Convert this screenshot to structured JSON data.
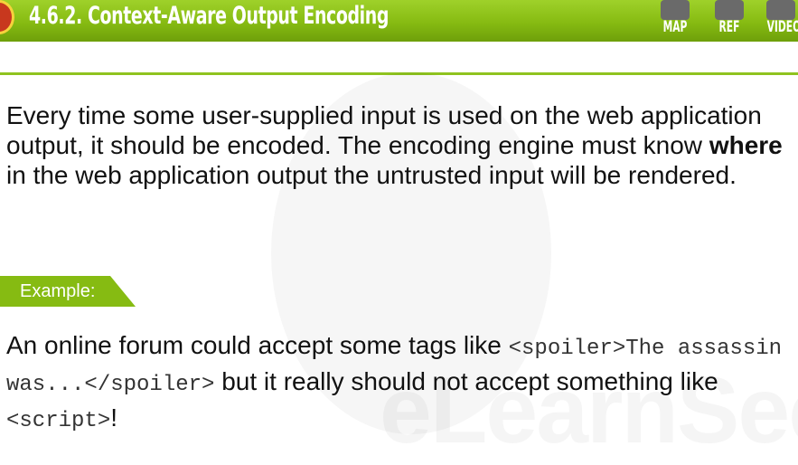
{
  "header": {
    "title": "4.6.2. Context-Aware Output Encoding",
    "nav": [
      {
        "label": "MAP",
        "icon": "map-icon"
      },
      {
        "label": "REF",
        "icon": "ref-icon"
      },
      {
        "label": "VIDEO",
        "icon": "video-icon"
      }
    ]
  },
  "body": {
    "para1_a": "Every time some user-supplied input is used on the web application output, it should be encoded. The encoding engine must know ",
    "para1_bold": "where",
    "para1_b": " in the web application output the untrusted input will be rendered.",
    "example_label": "Example:",
    "para2_a": "An online forum could accept some tags like ",
    "para2_code1": "<spoiler>The assassin was...</spoiler>",
    "para2_b": " but it really should not accept something like ",
    "para2_code2": "<script>",
    "para2_c": "!"
  },
  "watermark": "eLearnSecurity",
  "colors": {
    "accent": "#86bb12",
    "text": "#111111"
  }
}
